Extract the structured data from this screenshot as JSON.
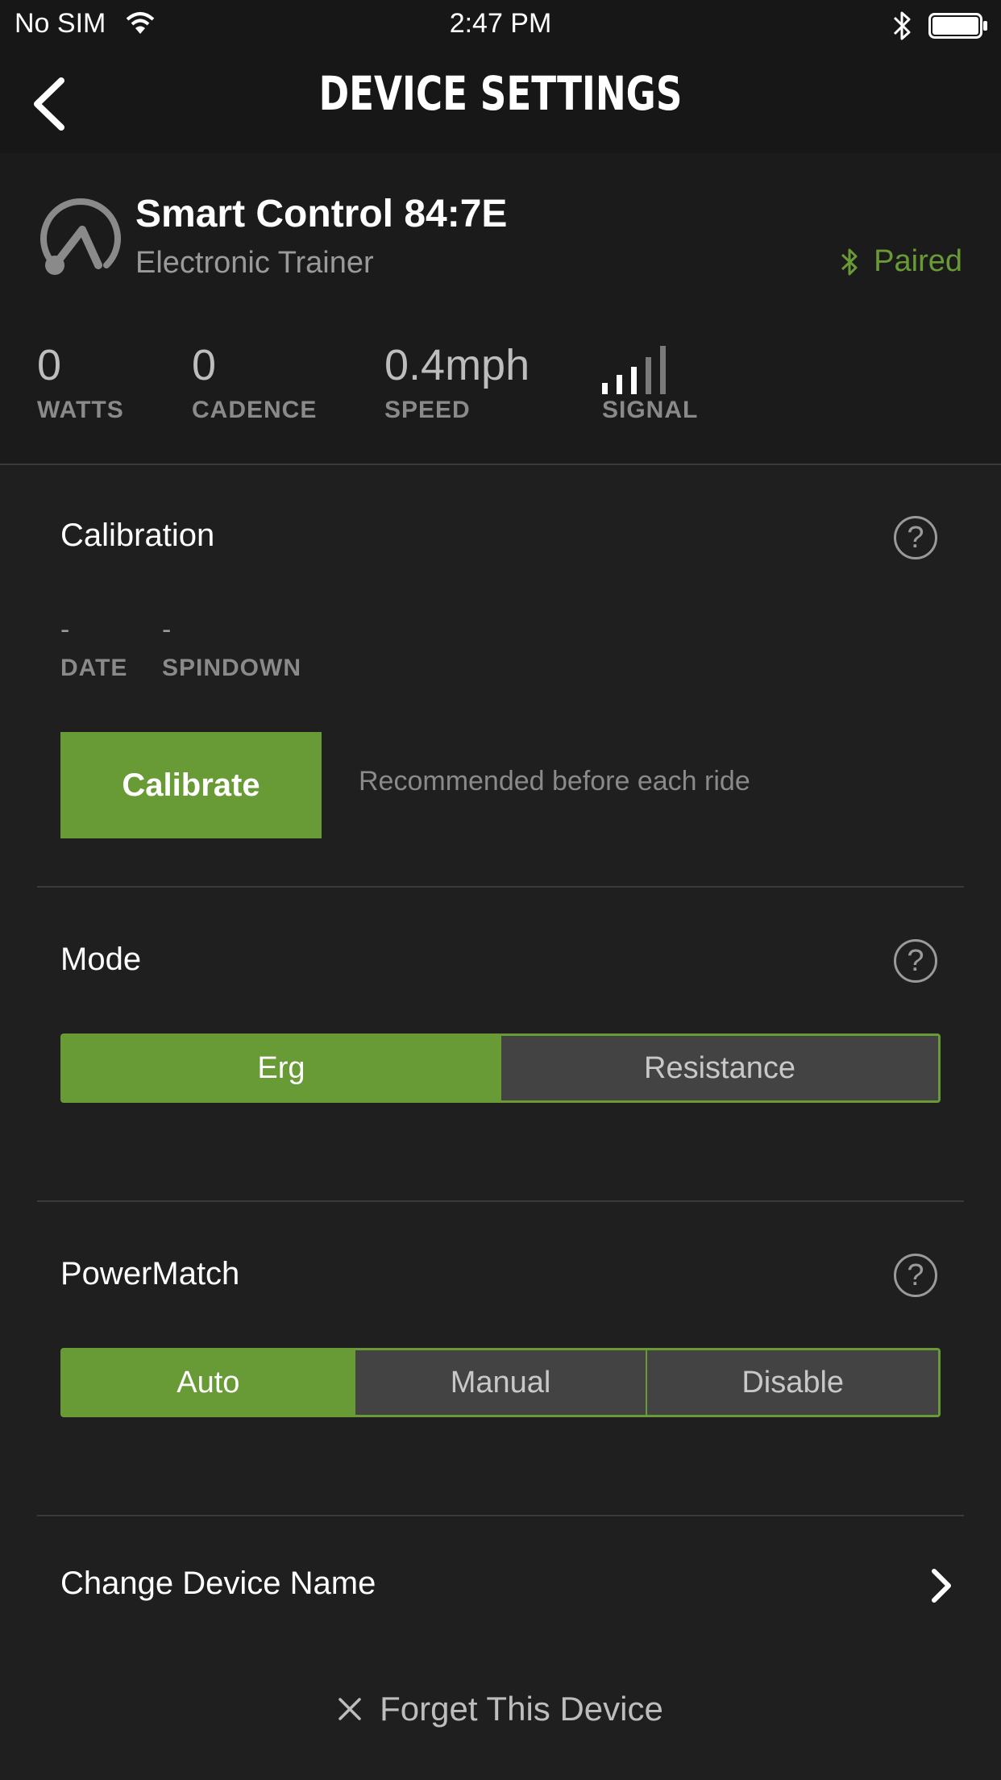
{
  "status_bar": {
    "carrier": "No SIM",
    "time": "2:47 PM",
    "icons": [
      "wifi-icon",
      "bluetooth-icon",
      "battery-icon"
    ]
  },
  "header": {
    "title": "DEVICE SETTINGS",
    "back_icon": "chevron-left-icon"
  },
  "device": {
    "name": "Smart Control 84:7E",
    "type": "Electronic Trainer",
    "status": "Paired",
    "status_icon": "bluetooth-icon",
    "icon": "gauge-icon",
    "stats": [
      {
        "value": "0",
        "label": "WATTS"
      },
      {
        "value": "0",
        "label": "CADENCE"
      },
      {
        "value": "0.4mph",
        "label": "SPEED"
      }
    ],
    "signal": {
      "label": "SIGNAL",
      "bars_total": 5,
      "bars_strong": 3
    }
  },
  "calibration": {
    "title": "Calibration",
    "date_value": "-",
    "date_label": "DATE",
    "spindown_value": "-",
    "spindown_label": "SPINDOWN",
    "button_label": "Calibrate",
    "hint": "Recommended before each ride"
  },
  "mode": {
    "title": "Mode",
    "options": [
      "Erg",
      "Resistance"
    ],
    "selected": "Erg"
  },
  "powermatch": {
    "title": "PowerMatch",
    "options": [
      "Auto",
      "Manual",
      "Disable"
    ],
    "selected": "Auto"
  },
  "change_name": {
    "label": "Change Device Name"
  },
  "forget": {
    "label": "Forget This Device"
  },
  "colors": {
    "accent": "#689a35",
    "background": "#1f1f1f",
    "header_bg": "#171717",
    "segment_inactive": "#434343"
  }
}
